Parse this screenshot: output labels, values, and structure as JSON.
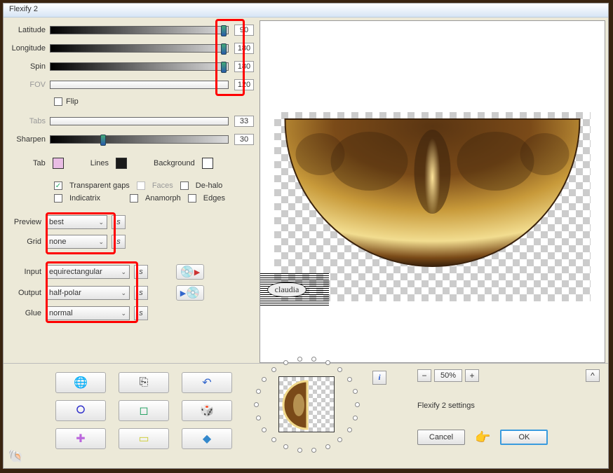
{
  "title": "Flexify 2",
  "sliders": {
    "latitude": {
      "label": "Latitude",
      "value": "90"
    },
    "longitude": {
      "label": "Longitude",
      "value": "180"
    },
    "spin": {
      "label": "Spin",
      "value": "180"
    },
    "fov": {
      "label": "FOV",
      "value": "120"
    },
    "tabs": {
      "label": "Tabs",
      "value": "33"
    },
    "sharpen": {
      "label": "Sharpen",
      "value": "30"
    }
  },
  "flip": {
    "label": "Flip",
    "checked": false
  },
  "colors": {
    "tab_label": "Tab",
    "lines_label": "Lines",
    "background_label": "Background",
    "tab": "#e9bde4",
    "lines": "#1a1a1a",
    "background": "#ffffff"
  },
  "checks": {
    "transparent_gaps": {
      "label": "Transparent gaps",
      "checked": true
    },
    "faces": {
      "label": "Faces",
      "checked": false,
      "disabled": true
    },
    "dehalo": {
      "label": "De-halo",
      "checked": false
    },
    "indicatrix": {
      "label": "Indicatrix",
      "checked": false
    },
    "anamorph": {
      "label": "Anamorph",
      "checked": false
    },
    "edges": {
      "label": "Edges",
      "checked": false
    }
  },
  "preview": {
    "label": "Preview",
    "value": "best"
  },
  "grid": {
    "label": "Grid",
    "value": "none"
  },
  "input": {
    "label": "Input",
    "value": "equirectangular"
  },
  "output": {
    "label": "Output",
    "value": "half-polar"
  },
  "glue": {
    "label": "Glue",
    "value": "normal"
  },
  "zoom": {
    "minus": "−",
    "plus": "+",
    "value": "50%"
  },
  "caret": "^",
  "settings_label": "Flexify 2 settings",
  "buttons": {
    "cancel": "Cancel",
    "ok": "OK"
  },
  "info_glyph": "i",
  "s_glyph": "s",
  "icons": {
    "globe": "🌐",
    "copy": "⎘",
    "undo": "↶",
    "torus": "⭘",
    "cube": "◻",
    "dice": "🎲",
    "plus": "✚",
    "brick": "▭",
    "gem": "◆",
    "shell": "🐚",
    "disc": "💿",
    "play": "▶",
    "hand": "👉"
  }
}
